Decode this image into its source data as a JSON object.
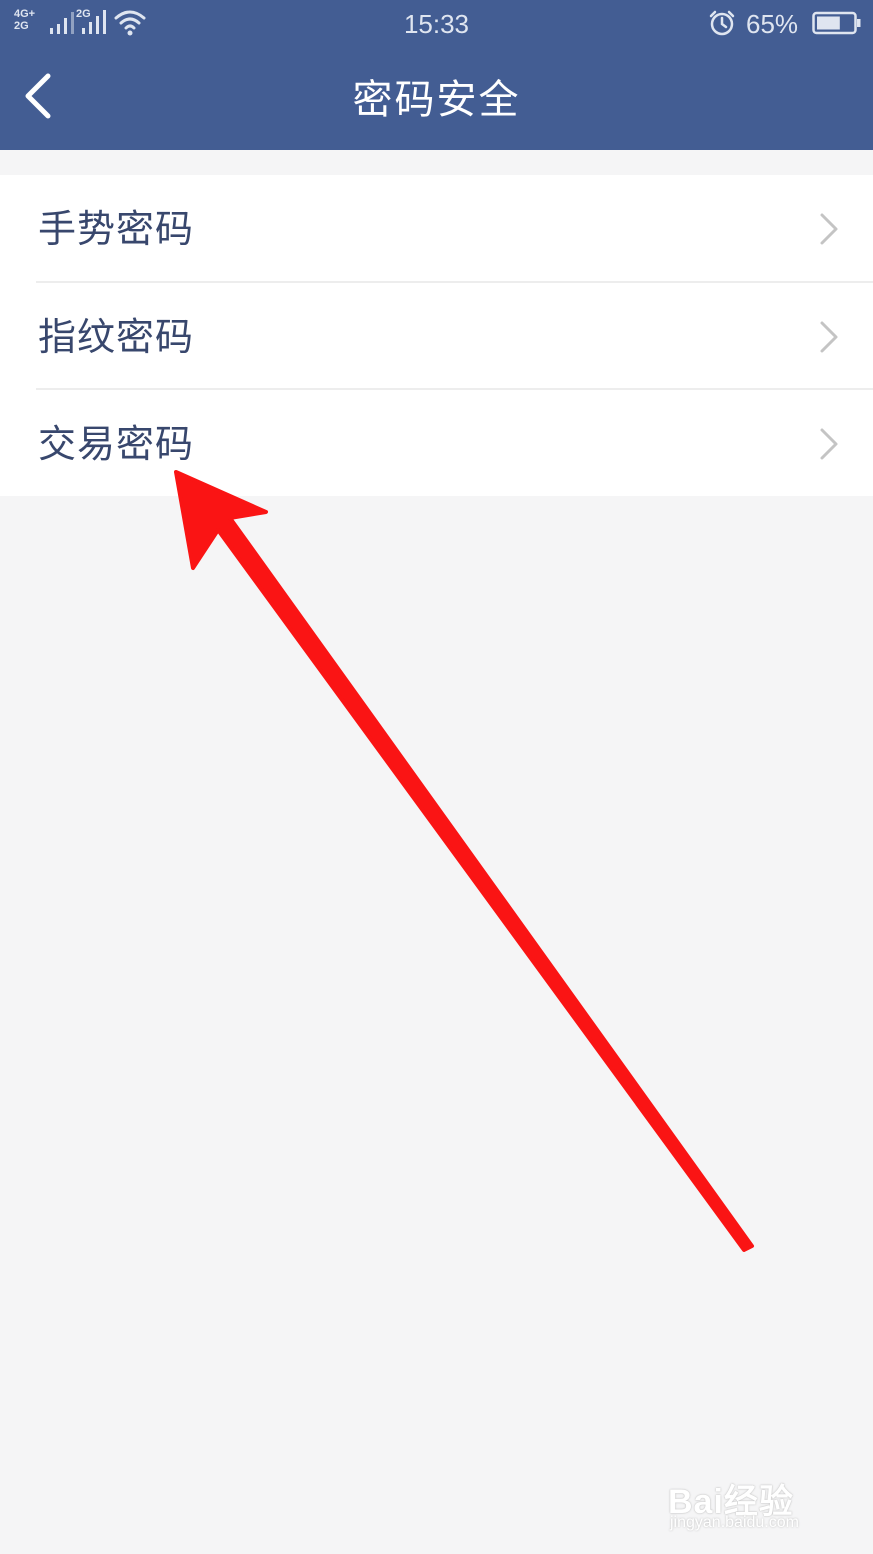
{
  "status_bar": {
    "network_primary": "4G+",
    "network_primary_sub": "2G",
    "network_secondary": "2G",
    "time": "15:33",
    "battery_percent": "65%",
    "battery_level": 0.65,
    "icons": [
      "signal-icon",
      "signal-icon",
      "wifi-icon",
      "alarm-icon",
      "battery-icon"
    ]
  },
  "nav": {
    "back_icon": "chevron-left-icon",
    "title": "密码安全"
  },
  "menu": {
    "items": [
      {
        "label": "手势密码",
        "icon": "chevron-right-icon"
      },
      {
        "label": "指纹密码",
        "icon": "chevron-right-icon"
      },
      {
        "label": "交易密码",
        "icon": "chevron-right-icon"
      }
    ]
  },
  "annotation": {
    "type": "arrow",
    "color": "#fa1414",
    "points_to": "交易密码"
  },
  "watermark": {
    "brand": "Bai经验",
    "url": "jingyan.baidu.com"
  },
  "colors": {
    "header_bg": "#435d93",
    "page_bg": "#f5f5f6",
    "item_text": "#38476d",
    "chevron": "#c4c4c4"
  }
}
